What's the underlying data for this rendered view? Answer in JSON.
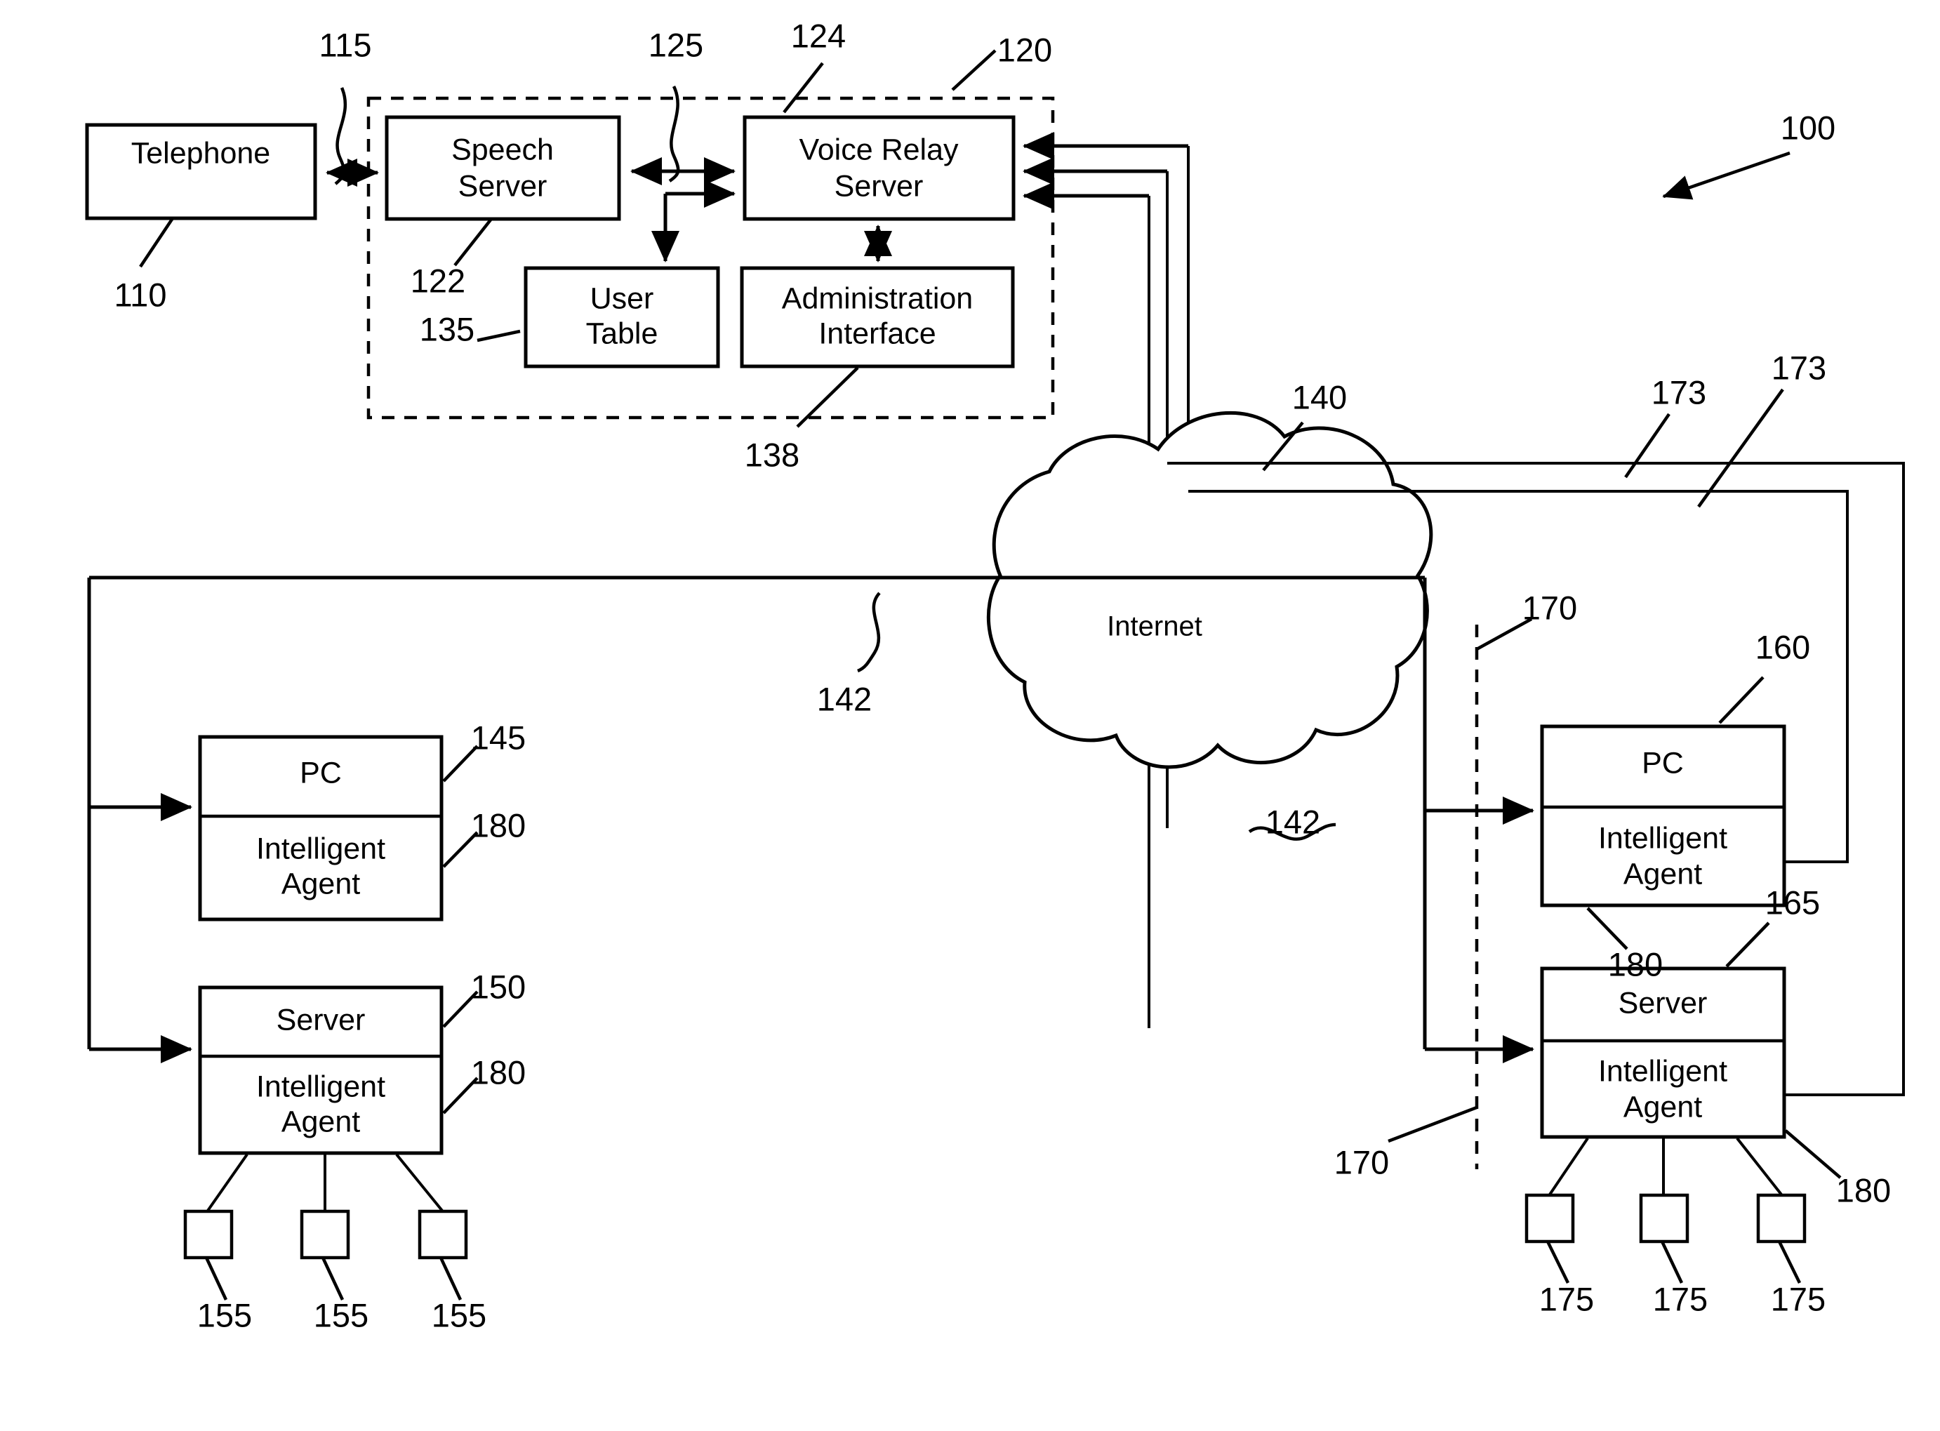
{
  "figure": {
    "system_ref": "100",
    "background_color": "#ffffff",
    "line_color": "#000000"
  },
  "nodes": {
    "telephone": {
      "label": "Telephone",
      "ref": "110"
    },
    "speech_server": {
      "label_line1": "Speech",
      "label_line2": "Server",
      "ref": "122"
    },
    "voice_relay_server": {
      "label_line1": "Voice Relay",
      "label_line2": "Server",
      "ref": "124"
    },
    "user_table": {
      "label_line1": "User",
      "label_line2": "Table",
      "ref": "135"
    },
    "administration_interface": {
      "label_line1": "Administration",
      "label_line2": "Interface",
      "ref": "138"
    },
    "relay_group": {
      "ref": "120"
    },
    "internet": {
      "label": "Internet",
      "ref": "140"
    },
    "local_pc": {
      "label": "PC",
      "ref": "145"
    },
    "local_pc_agent": {
      "label_line1": "Intelligent",
      "label_line2": "Agent",
      "ref": "180"
    },
    "local_server": {
      "label": "Server",
      "ref": "150"
    },
    "local_server_agent": {
      "label_line1": "Intelligent",
      "label_line2": "Agent",
      "ref": "180"
    },
    "remote_pc": {
      "label": "PC",
      "ref": "160"
    },
    "remote_pc_agent": {
      "label_line1": "Intelligent",
      "label_line2": "Agent",
      "ref": "180"
    },
    "remote_server": {
      "label": "Server",
      "ref": "165"
    },
    "remote_server_agent": {
      "label_line1": "Intelligent",
      "label_line2": "Agent",
      "ref": "180"
    }
  },
  "links": {
    "telephone_to_speech": "115",
    "speech_to_relay": "125",
    "internet_link_left": "142",
    "internet_link_right": "142",
    "firewall_boundary_top": "170",
    "firewall_boundary_bottom": "170",
    "return_path_upper": "173",
    "return_path_lower": "173"
  },
  "terminals": {
    "local": [
      {
        "ref": "155"
      },
      {
        "ref": "155"
      },
      {
        "ref": "155"
      }
    ],
    "remote": [
      {
        "ref": "175"
      },
      {
        "ref": "175"
      },
      {
        "ref": "175"
      }
    ]
  },
  "refs": {
    "r100": "100",
    "r110": "110",
    "r115": "115",
    "r120": "120",
    "r122": "122",
    "r124": "124",
    "r125": "125",
    "r135": "135",
    "r138": "138",
    "r140": "140",
    "r142a": "142",
    "r142b": "142",
    "r145": "145",
    "r150": "150",
    "r155a": "155",
    "r155b": "155",
    "r155c": "155",
    "r160": "160",
    "r165": "165",
    "r170a": "170",
    "r170b": "170",
    "r173a": "173",
    "r173b": "173",
    "r175a": "175",
    "r175b": "175",
    "r175c": "175",
    "r180a": "180",
    "r180b": "180",
    "r180c": "180",
    "r180d": "180"
  }
}
